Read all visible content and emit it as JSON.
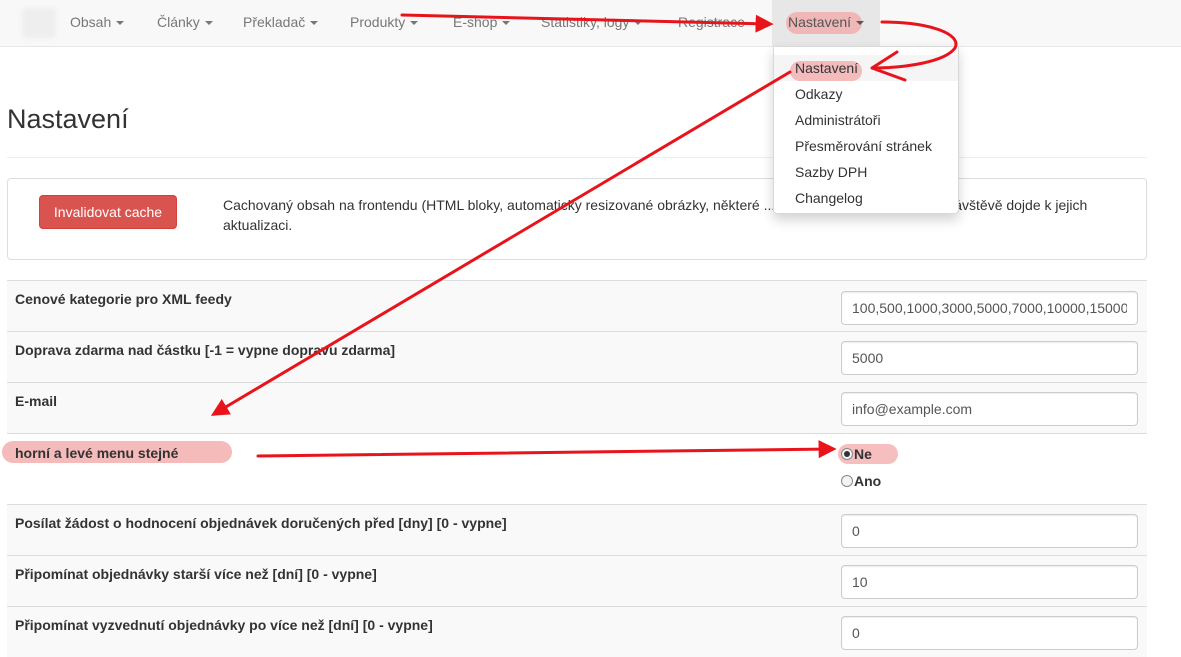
{
  "navbar": {
    "items": [
      {
        "label": "Obsah"
      },
      {
        "label": "Články"
      },
      {
        "label": "Překladač"
      },
      {
        "label": "Produkty"
      },
      {
        "label": "E-shop"
      },
      {
        "label": "Statistiky, logy"
      },
      {
        "label": "Registrace"
      },
      {
        "label": "Nastavení"
      }
    ],
    "dropdown": [
      "Nastavení",
      "Odkazy",
      "Administrátoři",
      "Přesměrování stránek",
      "Sazby DPH",
      "Changelog"
    ]
  },
  "page": {
    "title": "Nastavení",
    "cache_button": "Invalidovat cache",
    "cache_description": "Cachovaný obsah na frontendu (HTML bloky, automaticky resizované obrázky, některé ... budou smazány a při další návštěvě dojde k jejich aktualizaci."
  },
  "settings": [
    {
      "label": "Cenové kategorie pro XML feedy",
      "value": "100,500,1000,3000,5000,7000,10000,15000"
    },
    {
      "label": "Doprava zdarma nad částku [-1 = vypne dopravu zdarma]",
      "value": "5000"
    },
    {
      "label": "E-mail",
      "value": "info@example.com"
    },
    {
      "label": "horní a levé menu stejné",
      "options": [
        "Ne",
        "Ano"
      ],
      "selected": "Ne"
    },
    {
      "label": "Posílat žádost o hodnocení objednávek doručených před [dny] [0 - vypne]",
      "value": "0"
    },
    {
      "label": "Připomínat objednávky starší více než [dní] [0 - vypne]",
      "value": "10"
    },
    {
      "label": "Připomínat vyzvednutí objednávky po více než [dní] [0 - vypne]",
      "value": "0"
    }
  ],
  "colors": {
    "annotation": "#e8141b",
    "highlight": "#f2a3a3",
    "danger_button": "#d9534f"
  }
}
